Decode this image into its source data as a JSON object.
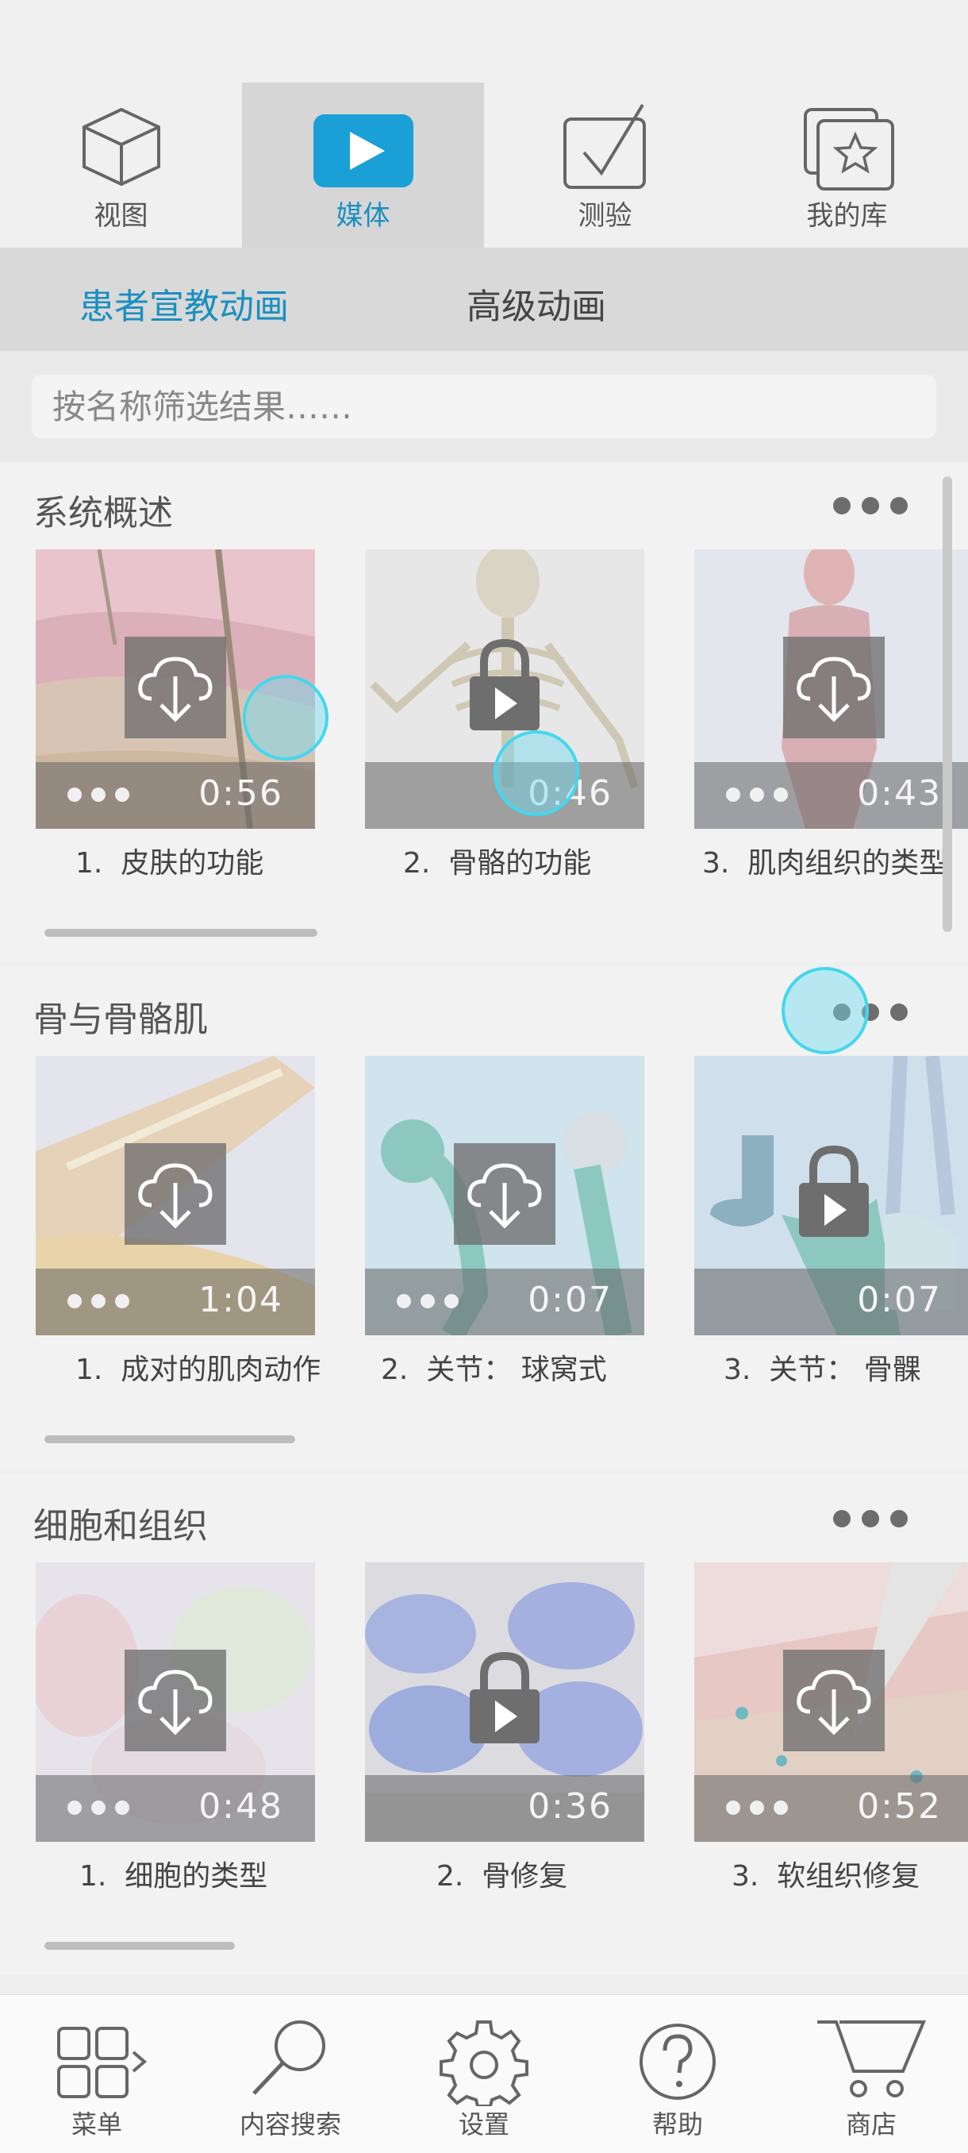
{
  "top_tabs": [
    {
      "label": "视图",
      "icon": "cube-icon"
    },
    {
      "label": "媒体",
      "icon": "play-icon",
      "active": true
    },
    {
      "label": "测验",
      "icon": "checkbox-icon"
    },
    {
      "label": "我的库",
      "icon": "star-library-icon"
    }
  ],
  "sub_tabs": [
    {
      "label": "患者宣教动画",
      "active": true
    },
    {
      "label": "高级动画"
    }
  ],
  "search": {
    "placeholder": "按名称筛选结果……"
  },
  "sections": [
    {
      "title": "系统概述",
      "items": [
        {
          "index": "1.",
          "title": "皮肤的功能",
          "duration": "0:56",
          "state": "download"
        },
        {
          "index": "2.",
          "title": "骨骼的功能",
          "duration": "0:46",
          "state": "locked"
        },
        {
          "index": "3.",
          "title": "肌肉组织的类型",
          "duration": "0:43",
          "state": "download"
        }
      ]
    },
    {
      "title": "骨与骨骼肌",
      "items": [
        {
          "index": "1.",
          "title": "成对的肌肉动作",
          "duration": "1:04",
          "state": "download"
        },
        {
          "index": "2.",
          "title": "关节： 球窝式",
          "duration": "0:07",
          "state": "download"
        },
        {
          "index": "3.",
          "title": "关节： 骨髁",
          "duration": "0:07",
          "state": "locked"
        }
      ]
    },
    {
      "title": "细胞和组织",
      "items": [
        {
          "index": "1.",
          "title": "细胞的类型",
          "duration": "0:48",
          "state": "download"
        },
        {
          "index": "2.",
          "title": "骨修复",
          "duration": "0:36",
          "state": "locked"
        },
        {
          "index": "3.",
          "title": "软组织修复",
          "duration": "0:52",
          "state": "download"
        }
      ]
    }
  ],
  "bottom_nav": [
    {
      "label": "菜单",
      "icon": "grid-menu-icon"
    },
    {
      "label": "内容搜索",
      "icon": "search-icon"
    },
    {
      "label": "设置",
      "icon": "gear-icon"
    },
    {
      "label": "帮助",
      "icon": "help-icon"
    },
    {
      "label": "商店",
      "icon": "cart-icon"
    }
  ],
  "colors": {
    "accent": "#1a8fc0",
    "touch": "#45d7ee"
  }
}
